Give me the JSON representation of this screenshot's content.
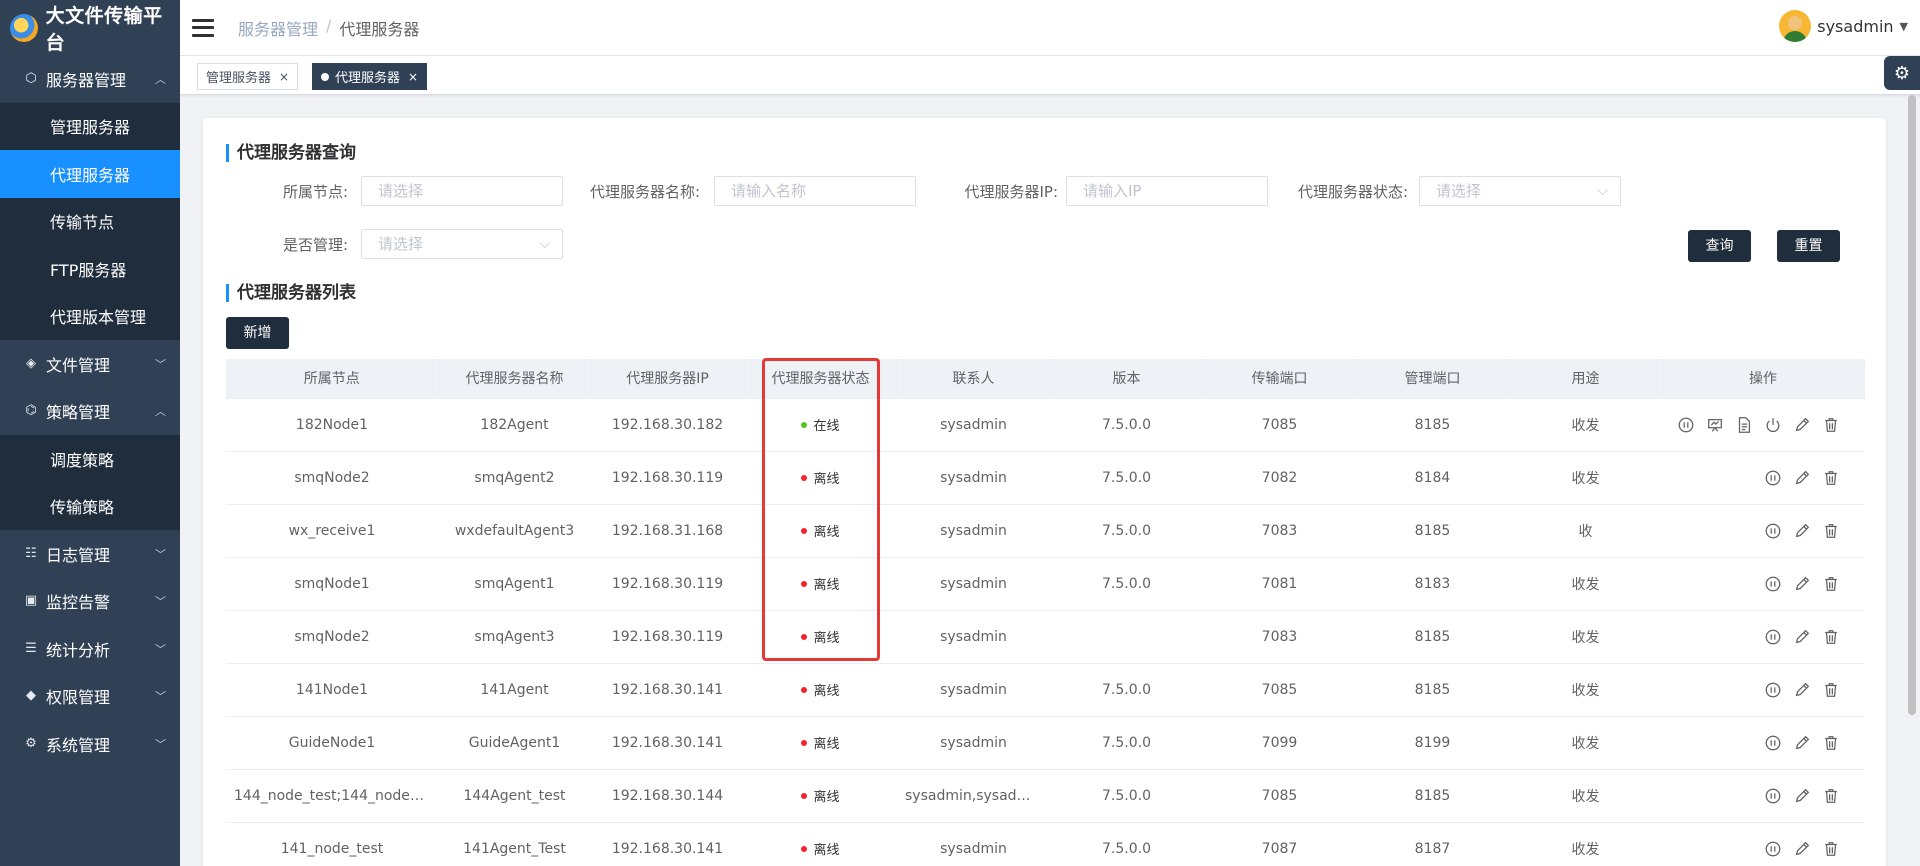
{
  "app": {
    "title": "大文件传输平台"
  },
  "sidebar": {
    "groups": [
      {
        "label": "服务器管理",
        "icon": "cube-icon",
        "expanded": true,
        "items": [
          "管理服务器",
          "代理服务器",
          "传输节点",
          "FTP服务器",
          "代理版本管理"
        ],
        "active": 1
      },
      {
        "label": "文件管理",
        "icon": "layers-icon",
        "expanded": false
      },
      {
        "label": "策略管理",
        "icon": "strategy-icon",
        "expanded": true,
        "items": [
          "调度策略",
          "传输策略"
        ]
      },
      {
        "label": "日志管理",
        "icon": "log-icon",
        "expanded": false
      },
      {
        "label": "监控告警",
        "icon": "monitor-icon",
        "expanded": false
      },
      {
        "label": "统计分析",
        "icon": "stats-icon",
        "expanded": false
      },
      {
        "label": "权限管理",
        "icon": "permission-icon",
        "expanded": false
      },
      {
        "label": "系统管理",
        "icon": "settings-icon",
        "expanded": false
      }
    ]
  },
  "header": {
    "breadcrumb": [
      "服务器管理",
      "代理服务器"
    ],
    "user": "sysadmin"
  },
  "tabs": [
    {
      "label": "管理服务器",
      "active": false
    },
    {
      "label": "代理服务器",
      "active": true
    }
  ],
  "query": {
    "title": "代理服务器查询",
    "fields": {
      "node": {
        "label": "所属节点:",
        "placeholder": "请选择"
      },
      "name": {
        "label": "代理服务器名称:",
        "placeholder": "请输入名称"
      },
      "ip": {
        "label": "代理服务器IP:",
        "placeholder": "请输入IP"
      },
      "status": {
        "label": "代理服务器状态:",
        "placeholder": "请选择"
      },
      "managed": {
        "label": "是否管理:",
        "placeholder": "请选择"
      }
    },
    "search_btn": "查询",
    "reset_btn": "重置"
  },
  "list": {
    "title": "代理服务器列表",
    "add_btn": "新增",
    "columns": [
      "所属节点",
      "代理服务器名称",
      "代理服务器IP",
      "代理服务器状态",
      "联系人",
      "版本",
      "传输端口",
      "管理端口",
      "用途",
      "操作"
    ],
    "rows": [
      {
        "node": "182Node1",
        "name": "182Agent",
        "ip": "192.168.30.182",
        "status": "在线",
        "online": true,
        "contact": "sysadmin",
        "version": "7.5.0.0",
        "tport": "7085",
        "mport": "8185",
        "usage": "收发"
      },
      {
        "node": "smqNode2",
        "name": "smqAgent2",
        "ip": "192.168.30.119",
        "status": "离线",
        "online": false,
        "contact": "sysadmin",
        "version": "7.5.0.0",
        "tport": "7082",
        "mport": "8184",
        "usage": "收发"
      },
      {
        "node": "wx_receive1",
        "name": "wxdefaultAgent3",
        "ip": "192.168.31.168",
        "status": "离线",
        "online": false,
        "contact": "sysadmin",
        "version": "7.5.0.0",
        "tport": "7083",
        "mport": "8185",
        "usage": "收"
      },
      {
        "node": "smqNode1",
        "name": "smqAgent1",
        "ip": "192.168.30.119",
        "status": "离线",
        "online": false,
        "contact": "sysadmin",
        "version": "7.5.0.0",
        "tport": "7081",
        "mport": "8183",
        "usage": "收发"
      },
      {
        "node": "smqNode2",
        "name": "smqAgent3",
        "ip": "192.168.30.119",
        "status": "离线",
        "online": false,
        "contact": "sysadmin",
        "version": "",
        "tport": "7083",
        "mport": "8185",
        "usage": "收发"
      },
      {
        "node": "141Node1",
        "name": "141Agent",
        "ip": "192.168.30.141",
        "status": "离线",
        "online": false,
        "contact": "sysadmin",
        "version": "7.5.0.0",
        "tport": "7085",
        "mport": "8185",
        "usage": "收发"
      },
      {
        "node": "GuideNode1",
        "name": "GuideAgent1",
        "ip": "192.168.30.141",
        "status": "离线",
        "online": false,
        "contact": "sysadmin",
        "version": "7.5.0.0",
        "tport": "7099",
        "mport": "8199",
        "usage": "收发"
      },
      {
        "node": "144_node_test;144_node_te...",
        "name": "144Agent_test",
        "ip": "192.168.30.144",
        "status": "离线",
        "online": false,
        "contact": "sysadmin,sysadmi...",
        "version": "7.5.0.0",
        "tport": "7085",
        "mport": "8185",
        "usage": "收发"
      },
      {
        "node": "141_node_test",
        "name": "141Agent_Test",
        "ip": "192.168.30.141",
        "status": "离线",
        "online": false,
        "contact": "sysadmin",
        "version": "7.5.0.0",
        "tport": "7087",
        "mport": "8187",
        "usage": "收发"
      }
    ]
  },
  "colors": {
    "online": "#52c41a",
    "offline": "#f5222d",
    "accent": "#1890ff",
    "sidebar": "#304156",
    "highlight": "#e53935"
  }
}
